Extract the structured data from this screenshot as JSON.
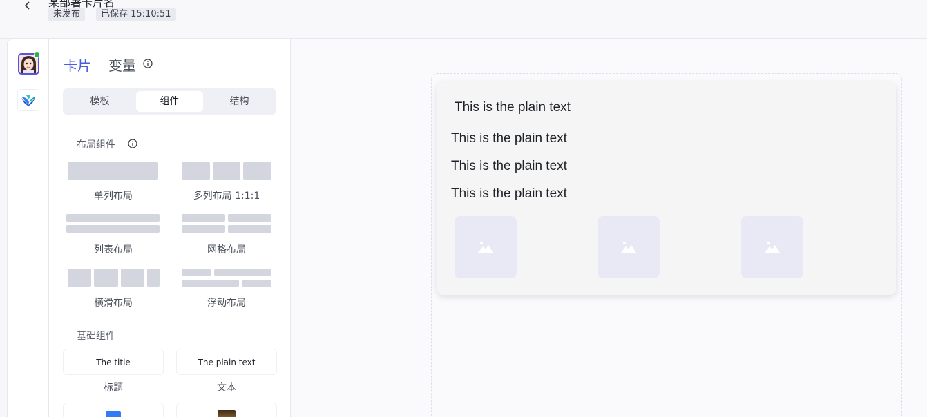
{
  "header": {
    "title": "某部署卡片名",
    "status": "未发布",
    "saved": "已保存 15:10:51"
  },
  "panel": {
    "tabs": [
      "卡片",
      "变量"
    ],
    "segments": [
      "模板",
      "组件",
      "结构"
    ],
    "active_segment": "组件",
    "layout_section": "布局组件",
    "layout_items": [
      "单列布局",
      "多列布局 1:1:1",
      "列表布局",
      "网格布局",
      "横滑布局",
      "浮动布局"
    ],
    "basic_section": "基础组件",
    "basic_items": [
      {
        "preview": "The title",
        "label": "标题"
      },
      {
        "preview": "The plain text",
        "label": "文本"
      }
    ]
  },
  "card": {
    "header_text": "This is the plain text",
    "lines": [
      "This is the plain text",
      "This is the plain text",
      "This is the plain text"
    ],
    "image_count": 3
  },
  "colors": {
    "accent": "#4c5ce0",
    "online": "#22b24c",
    "placeholder": "#d3d6de"
  },
  "icons": [
    "chevron-left-icon",
    "info-icon",
    "image-icon"
  ]
}
